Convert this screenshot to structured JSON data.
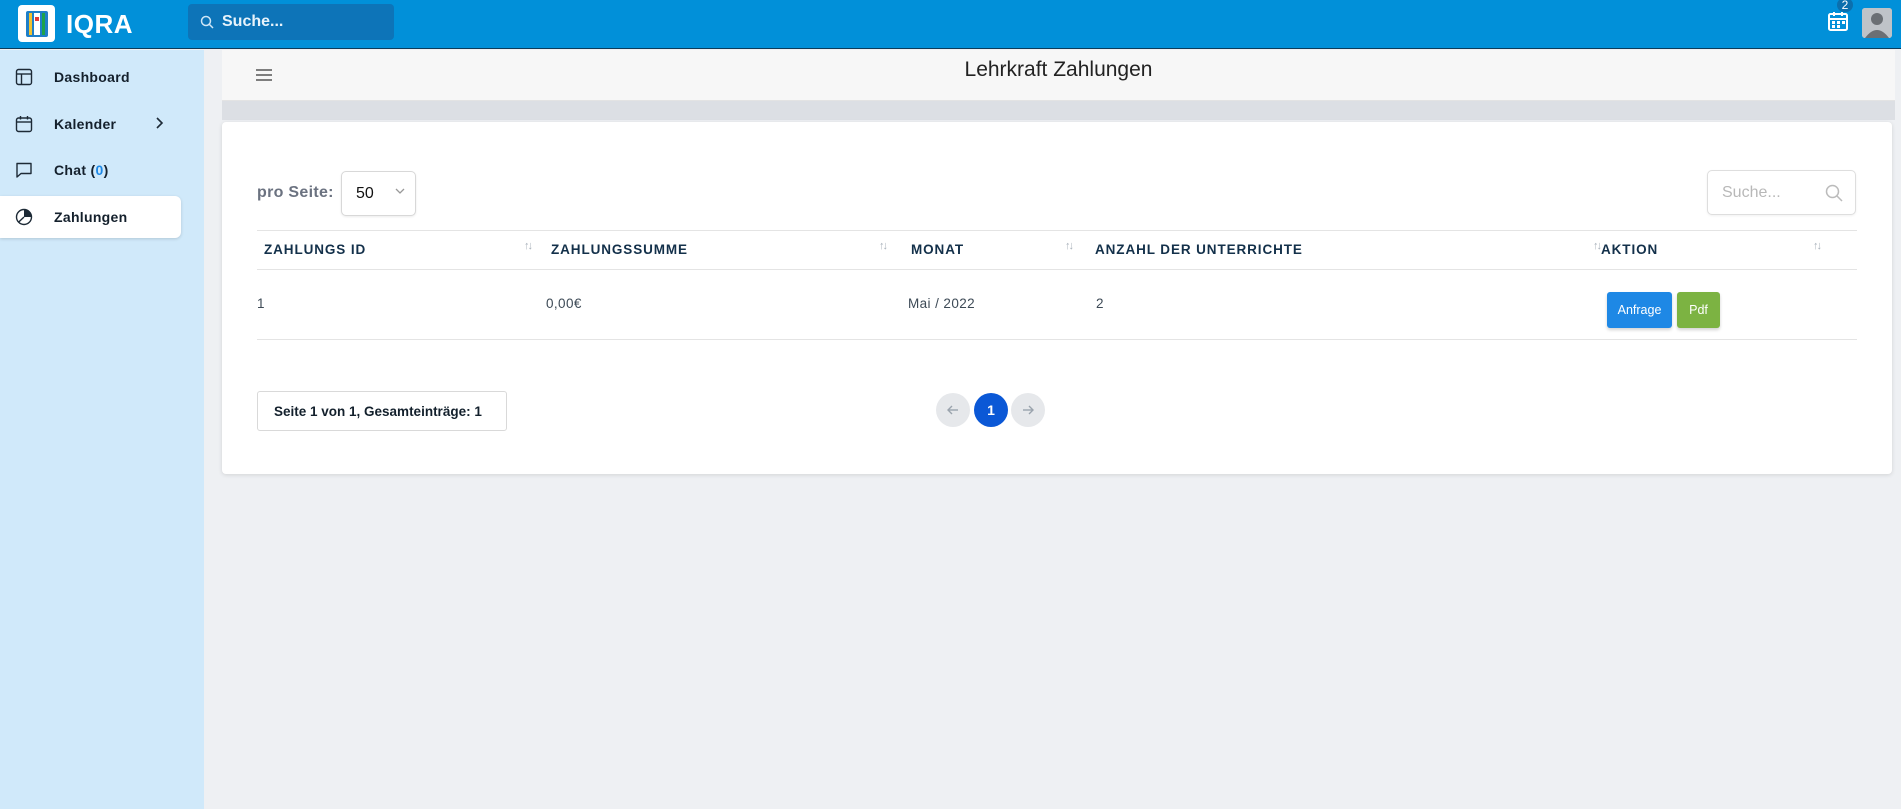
{
  "app": {
    "title": "IQRA"
  },
  "topbar": {
    "search_placeholder": "Suche...",
    "calendar_badge": "2"
  },
  "sidebar": {
    "items": [
      {
        "label": "Dashboard"
      },
      {
        "label": "Kalender"
      },
      {
        "label": "Chat (",
        "count": "0",
        "suffix": ")"
      },
      {
        "label": "Zahlungen"
      }
    ]
  },
  "page": {
    "title": "Lehrkraft Zahlungen"
  },
  "toolbar": {
    "per_page_label": "pro Seite:",
    "per_page_value": "50",
    "search_placeholder": "Suche..."
  },
  "table": {
    "columns": [
      "ZAHLUNGS ID",
      "ZAHLUNGSSUMME",
      "MONAT",
      "ANZAHL DER UNTERRICHTE",
      "AKTION"
    ],
    "rows": [
      {
        "id": "1",
        "sum": "0,00€",
        "month": "Mai / 2022",
        "count": "2",
        "action_request": "Anfrage",
        "action_pdf": "Pdf"
      }
    ]
  },
  "pagination": {
    "info": "Seite 1 von 1, Gesamteinträge: 1",
    "current": "1"
  },
  "colors": {
    "topbar": "#0190d9",
    "sidebar": "#d0e9fa",
    "primary": "#1e88e5",
    "success": "#7cb342",
    "page_active": "#0b58d6"
  },
  "icons": [
    "logo-icon",
    "search-icon",
    "calendar-icon",
    "avatar",
    "dashboard-icon",
    "calendar-icon",
    "chat-icon",
    "pie-chart-icon",
    "chevron-right-icon",
    "hamburger-icon",
    "chevron-down-icon",
    "sort-icon",
    "arrow-left-icon",
    "arrow-right-icon"
  ]
}
